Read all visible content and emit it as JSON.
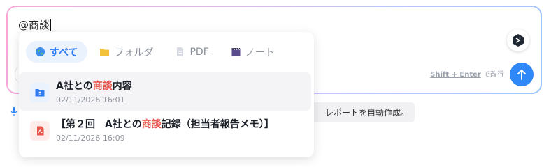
{
  "composer": {
    "input_value": "@商談",
    "hint_shortcut": "Shift + Enter",
    "hint_suffix": "で改行"
  },
  "background": {
    "suggestion_chip": "レポートを自動作成。"
  },
  "mention_popover": {
    "tabs": [
      {
        "label": "すべて",
        "icon": "globe-icon",
        "active": true
      },
      {
        "label": "フォルダ",
        "icon": "folder-icon",
        "active": false
      },
      {
        "label": "PDF",
        "icon": "pdf-file-icon",
        "active": false
      },
      {
        "label": "ノート",
        "icon": "clapperboard-icon",
        "active": false
      }
    ],
    "results": [
      {
        "type": "folder",
        "icon": "shared-folder-icon",
        "title_before": "A社との",
        "title_match": "商談",
        "title_after": "内容",
        "date": "02/11/2026 16:01"
      },
      {
        "type": "pdf",
        "icon": "pdf-file-icon",
        "title_before": "【第２回　A社との",
        "title_match": "商談",
        "title_after": "記録（担当者報告メモ）】",
        "date": "02/11/2026 16:09"
      }
    ]
  },
  "colors": {
    "accent": "#2f88f7",
    "highlight": "#e8534a",
    "active_tab_bg": "#eaf2fd"
  }
}
